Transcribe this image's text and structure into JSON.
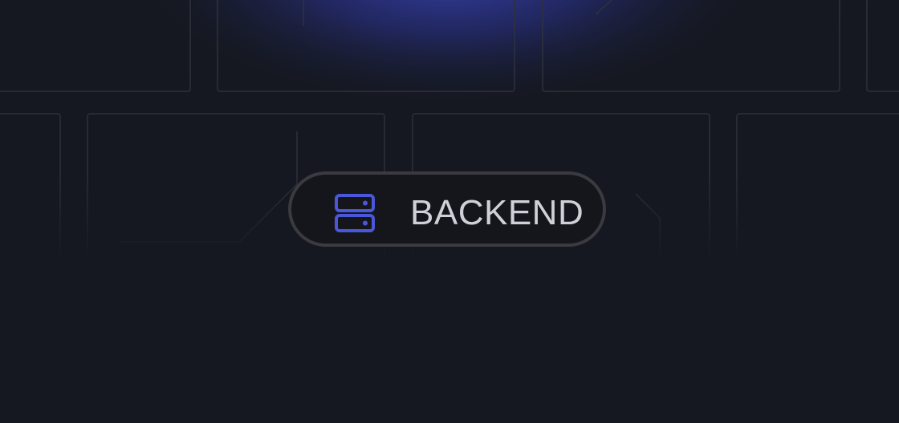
{
  "badge": {
    "label": "BACKEND",
    "icon": "server-icon"
  },
  "colors": {
    "background": "#151820",
    "glow": "#3a45b8",
    "accent": "#4a57d8",
    "pill_border": "#3a3a40",
    "label": "#cfd0d8"
  }
}
